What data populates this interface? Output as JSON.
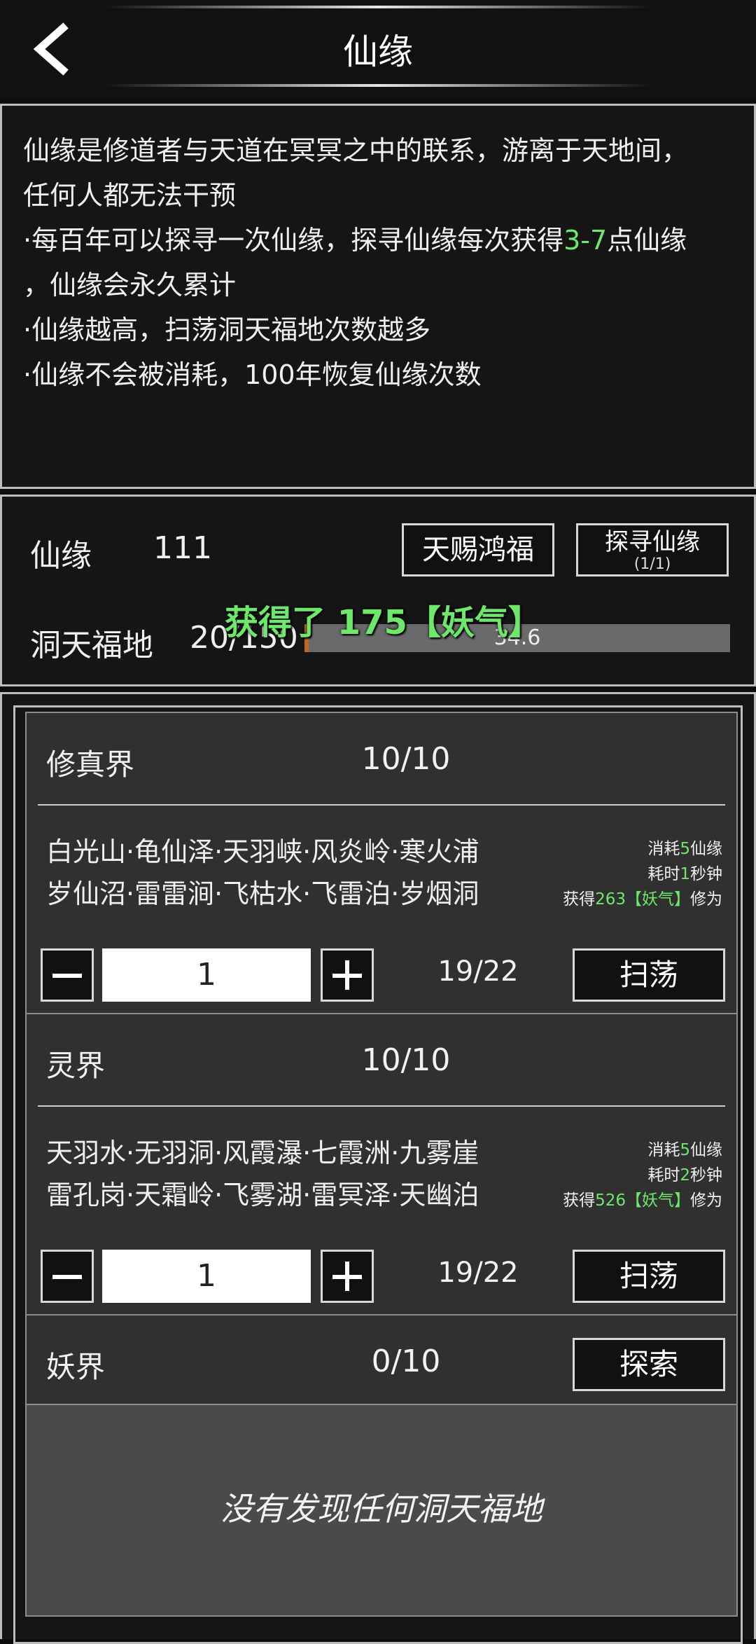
{
  "header": {
    "title": "仙缘"
  },
  "description": {
    "line1": "仙缘是修道者与天道在冥冥之中的联系，游离于天地间，",
    "line2": "任何人都无法干预",
    "line3_pre": "·每百年可以探寻一次仙缘，探寻仙缘每次获得",
    "line3_highlight": "3-7",
    "line3_post": "点仙缘",
    "line4": "，仙缘会永久累计",
    "line5": "·仙缘越高，扫荡洞天福地次数越多",
    "line6": "·仙缘不会被消耗，100年恢复仙缘次数"
  },
  "status": {
    "xianyuan_label": "仙缘",
    "xianyuan_value": "111",
    "tianci_button": "天赐鸿福",
    "tanxun_button": "探寻仙缘",
    "tanxun_count": "(1/1)",
    "dongtian_label": "洞天福地",
    "dongtian_value": "20/150",
    "progress_text": "34.6",
    "progress_fraction": 0.01
  },
  "toast": {
    "text": "获得了 175【妖气】"
  },
  "realms": [
    {
      "name": "修真界",
      "count": "10/10",
      "places_line1": "白光山·龟仙泽·天羽峡·风炎岭·寒火浦",
      "places_line2": "岁仙沼·雷雷涧·飞枯水·飞雷泊·岁烟洞",
      "cost_pre": "消耗",
      "cost_value": "5",
      "cost_post": "仙缘",
      "time_pre": "耗时",
      "time_value": "1",
      "time_post": "秒钟",
      "gain_pre": "获得",
      "gain_value": "263【妖气】",
      "gain_post": "修为",
      "quantity": "1",
      "attempts": "19/22",
      "sweep_label": "扫荡"
    },
    {
      "name": "灵界",
      "count": "10/10",
      "places_line1": "天羽水·无羽洞·风霞瀑·七霞洲·九雾崖",
      "places_line2": "雷孔岗·天霜岭·飞雾湖·雷冥泽·天幽泊",
      "cost_pre": "消耗",
      "cost_value": "5",
      "cost_post": "仙缘",
      "time_pre": "耗时",
      "time_value": "2",
      "time_post": "秒钟",
      "gain_pre": "获得",
      "gain_value": "526【妖气】",
      "gain_post": "修为",
      "quantity": "1",
      "attempts": "19/22",
      "sweep_label": "扫荡"
    },
    {
      "name": "妖界",
      "count": "0/10",
      "explore_label": "探索",
      "empty_text": "没有发现任何洞天福地"
    }
  ],
  "colors": {
    "highlight": "#6ee86a",
    "progress_fill": "#c0681f"
  }
}
